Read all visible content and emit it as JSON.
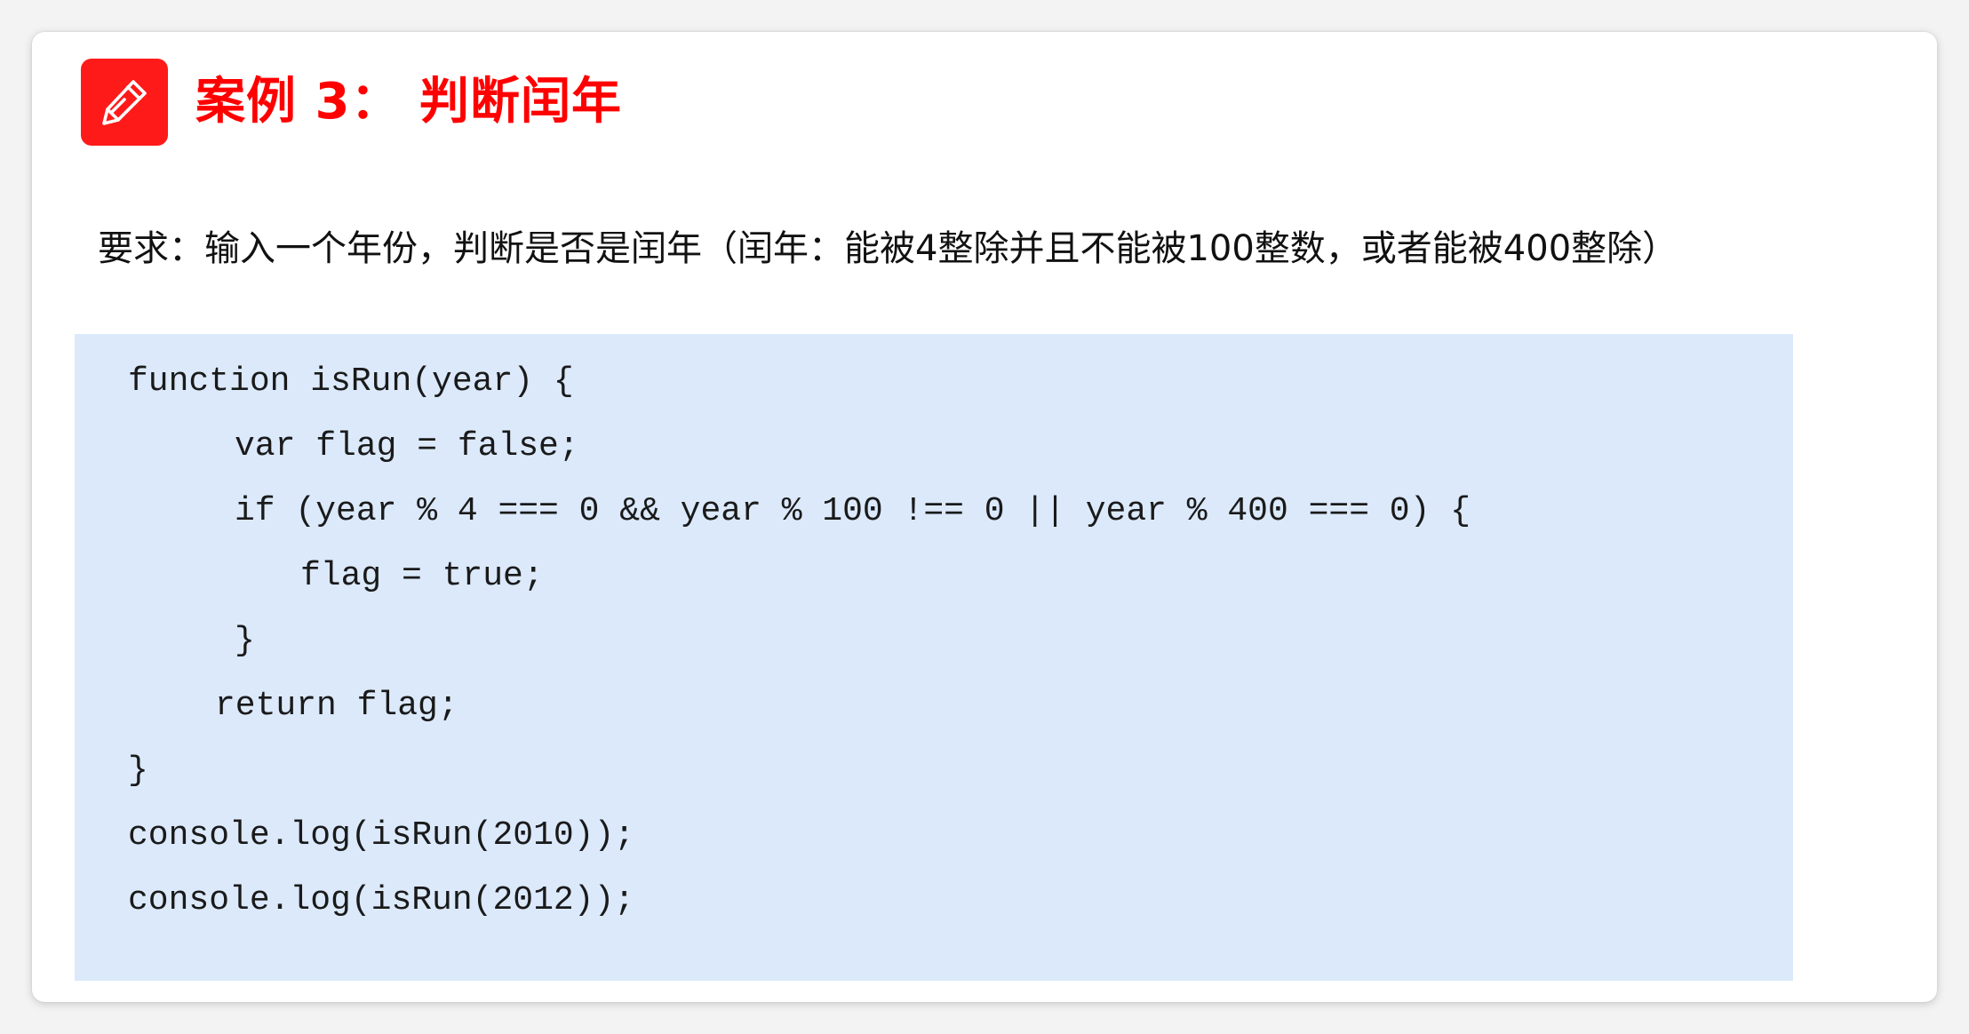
{
  "header": {
    "icon": "pencil-icon",
    "accent_color": "#ff1a1a",
    "title": "案例 3： 判断闰年"
  },
  "requirement": {
    "text": "要求：输入一个年份，判断是否是闰年（闰年：能被4整除并且不能被100整数，或者能被400整除）"
  },
  "code": {
    "background": "#dbe9fb",
    "lines": [
      "function isRun(year) {",
      "var flag = false;",
      "if (year % 4 === 0 && year % 100 !== 0 || year % 400 === 0) {",
      "flag = true;",
      "}",
      "return flag;",
      "}",
      "console.log(isRun(2010));",
      "console.log(isRun(2012));"
    ]
  }
}
